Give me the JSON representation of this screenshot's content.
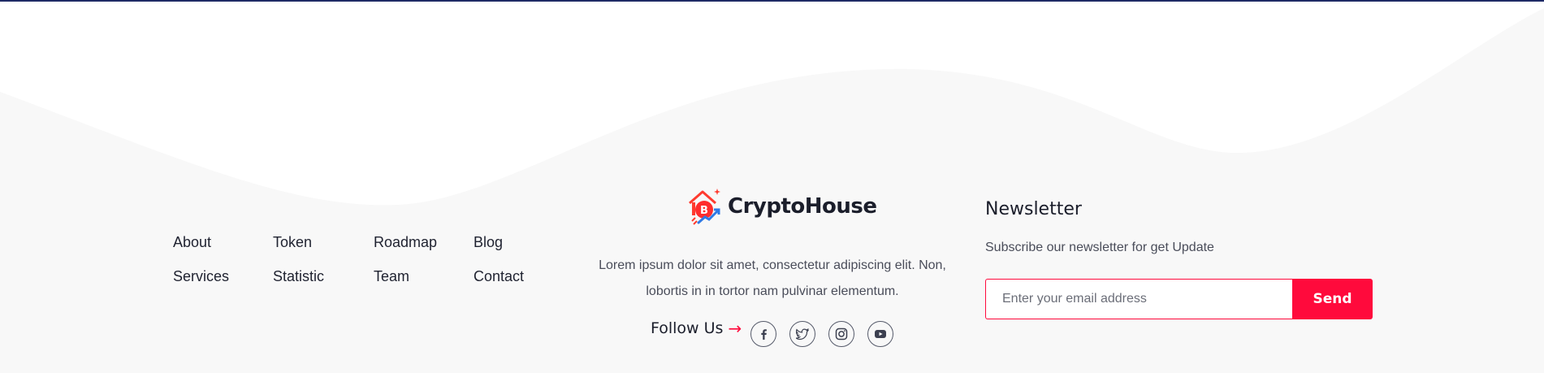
{
  "colors": {
    "accent": "#ff0a3c",
    "footer_bg": "#f8f8f8",
    "text": "#1f2230"
  },
  "footer": {
    "links": [
      {
        "label": "About"
      },
      {
        "label": "Token"
      },
      {
        "label": "Roadmap"
      },
      {
        "label": "Blog"
      },
      {
        "label": "Services"
      },
      {
        "label": "Statistic"
      },
      {
        "label": "Team"
      },
      {
        "label": "Contact"
      }
    ],
    "brand": {
      "name": "CryptoHouse",
      "logo_icon": "house-bitcoin-logo-icon"
    },
    "description": "Lorem ipsum dolor sit amet, consectetur adipiscing elit. Non, lobortis in in tortor nam pulvinar elementum.",
    "follow": {
      "label": "Follow Us",
      "arrow": "→",
      "socials": [
        {
          "icon": "facebook-icon"
        },
        {
          "icon": "twitter-icon"
        },
        {
          "icon": "instagram-icon"
        },
        {
          "icon": "youtube-icon"
        }
      ]
    },
    "newsletter": {
      "title": "Newsletter",
      "subtitle": "Subscribe our newsletter for get Update",
      "placeholder": "Enter your email address",
      "button_label": "Send"
    }
  }
}
